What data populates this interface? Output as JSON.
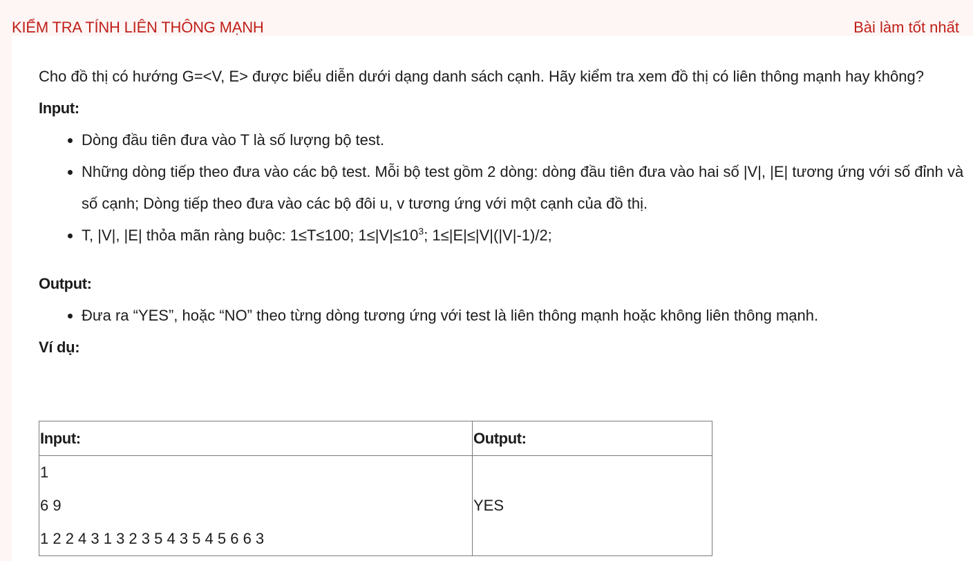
{
  "header": {
    "title": "KIỂM TRA TÍNH LIÊN THÔNG MẠNH",
    "best_link": "Bài làm tốt nhất"
  },
  "problem": {
    "intro": "Cho đồ thị có hướng G=<V, E> được biểu diễn dưới dạng danh sách cạnh. Hãy kiểm tra xem đồ thị có liên thông mạnh hay không?",
    "input_heading": "Input:",
    "input_items": [
      "Dòng đầu tiên đưa vào T là số lượng bộ test.",
      "Những dòng tiếp theo đưa vào các bộ test. Mỗi bộ test gồm 2 dòng: dòng đầu tiên đưa vào hai số |V|, |E| tương ứng với số đỉnh và số cạnh; Dòng tiếp theo đưa vào các bộ đôi u, v tương ứng với một cạnh của đồ thị."
    ],
    "constraint_prefix": "T, |V|, |E| thỏa mãn ràng buộc: 1≤T≤100; 1≤|V|≤10",
    "constraint_exp": "3",
    "constraint_suffix": "; 1≤|E|≤|V|(|V|-1)/2;",
    "output_heading": "Output:",
    "output_items": [
      "Đưa ra “YES”, hoặc “NO” theo từng dòng tương ứng với test là liên thông mạnh hoặc không liên thông mạnh."
    ],
    "example_heading": "Ví dụ:"
  },
  "example_table": {
    "headers": [
      "Input:",
      "Output:"
    ],
    "input_lines": [
      "1",
      "6 9",
      "1 2 2 4 3 1 3 2 3 5 4 3 5 4 5 6 6  3"
    ],
    "output": "YES"
  }
}
